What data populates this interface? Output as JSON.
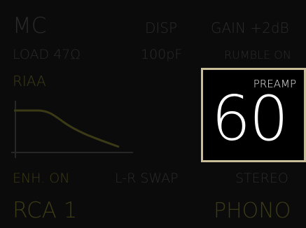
{
  "header": {
    "cartridge_mode": "MC",
    "display_button": "DISP",
    "gain_label": "GAIN +2dB"
  },
  "settings": {
    "load": "LOAD 47Ω",
    "capacitance": "100pF",
    "rumble": "RUMBLE ON",
    "eq_curve": "RIAA"
  },
  "volume": {
    "label": "PREAMP",
    "value": "60"
  },
  "options": {
    "enhance": "ENH. ON",
    "lr_swap": "L-R SWAP",
    "channel_mode": "STEREO"
  },
  "footer": {
    "input_name": "RCA 1",
    "source_type": "PHONO"
  },
  "colors": {
    "background": "#0b0b0b",
    "inactive_text": "#2a2a2a",
    "accent_olive": "#3b3a17",
    "volume_border": "#c9bd9a",
    "volume_text": "#ffffff"
  }
}
